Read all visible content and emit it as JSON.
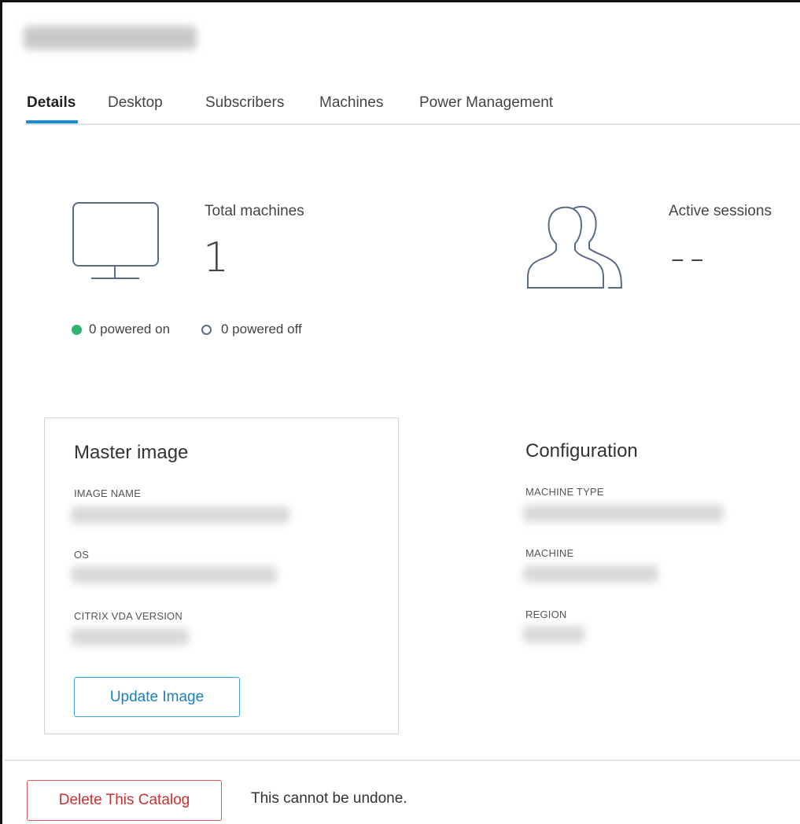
{
  "header": {
    "title_blurred": true
  },
  "tabs": [
    {
      "label": "Details",
      "active": true
    },
    {
      "label": "Desktop",
      "active": false
    },
    {
      "label": "Subscribers",
      "active": false
    },
    {
      "label": "Machines",
      "active": false
    },
    {
      "label": "Power Management",
      "active": false
    }
  ],
  "stats": {
    "total_machines": {
      "label": "Total machines",
      "value": "1",
      "icon": "monitor-icon"
    },
    "power": {
      "on": "0 powered on",
      "off": "0 powered off",
      "on_color": "#2bb673",
      "off_color": "#5a6b85"
    },
    "active_sessions": {
      "label": "Active sessions",
      "value": "--",
      "icon": "users-icon"
    }
  },
  "master_image": {
    "title": "Master image",
    "fields": [
      {
        "label": "IMAGE NAME"
      },
      {
        "label": "OS"
      },
      {
        "label": "CITRIX VDA VERSION"
      }
    ],
    "update_button": "Update Image"
  },
  "configuration": {
    "title": "Configuration",
    "fields": [
      {
        "label": "MACHINE TYPE"
      },
      {
        "label": "MACHINE"
      },
      {
        "label": "REGION"
      }
    ]
  },
  "footer": {
    "delete_button": "Delete This Catalog",
    "note": "This cannot be undone."
  },
  "colors": {
    "accent": "#1a8ad4",
    "danger": "#e05757",
    "success": "#2bb673"
  }
}
